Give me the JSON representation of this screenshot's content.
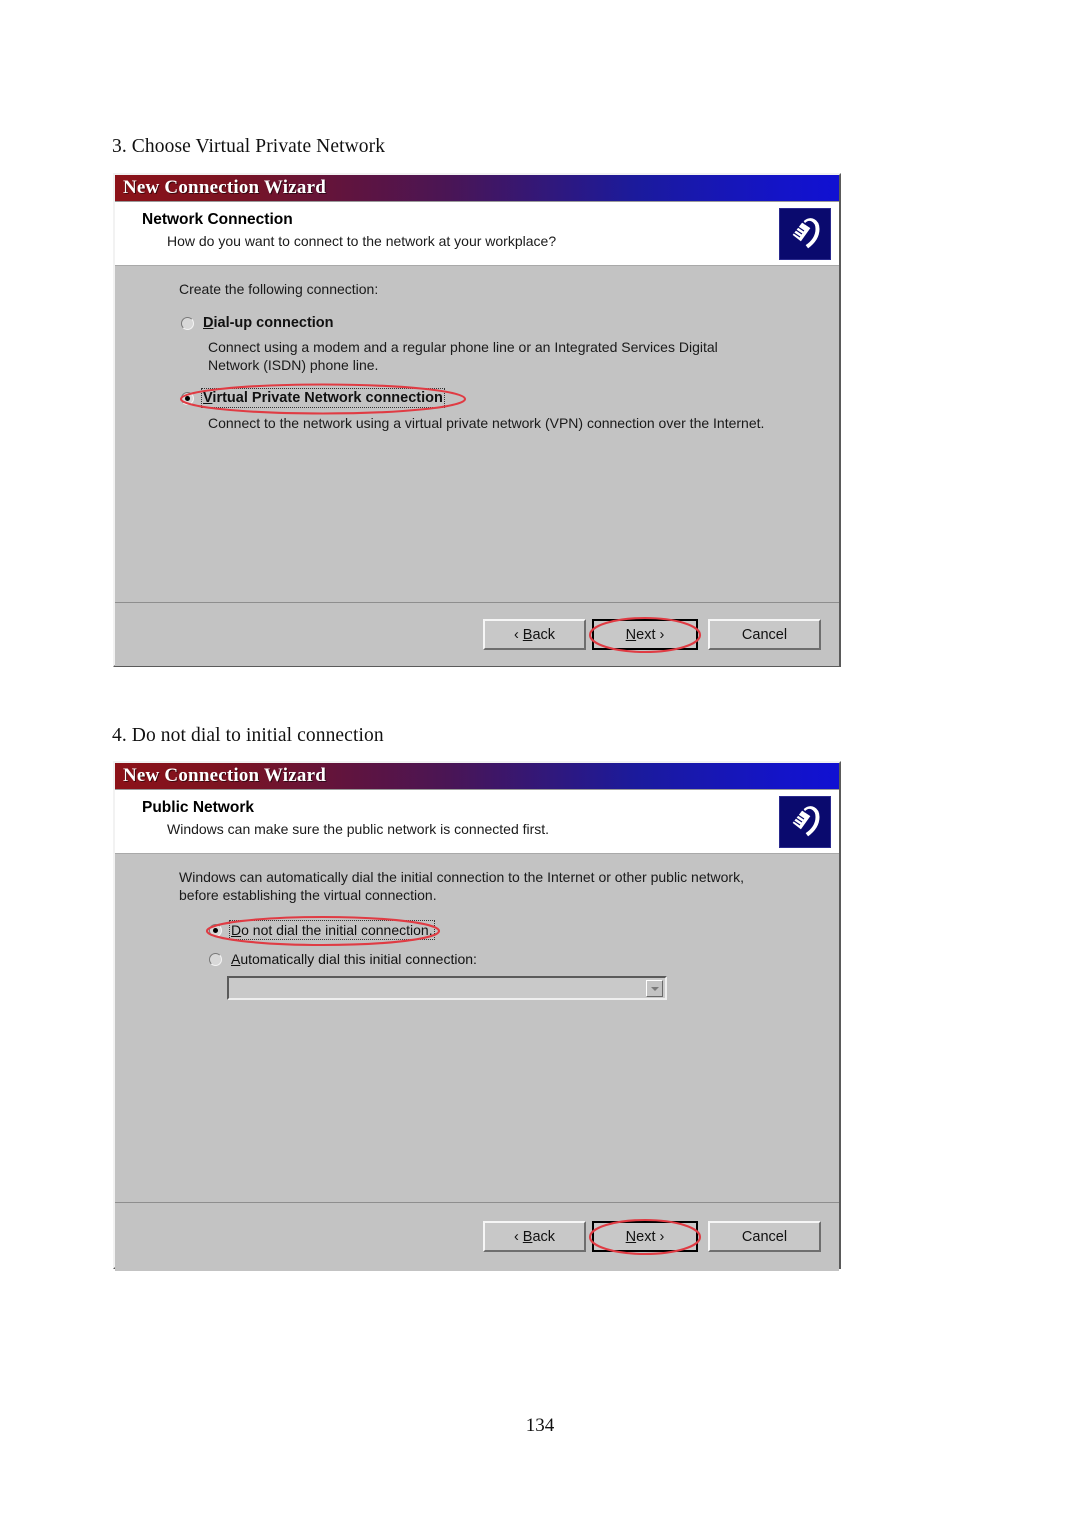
{
  "document": {
    "page_number": "134",
    "captions": [
      {
        "id": "c3",
        "text": "3. Choose Virtual Private Network"
      },
      {
        "id": "c4",
        "text": "4. Do not dial to initial connection"
      }
    ]
  },
  "colors": {
    "titlebar_start": "#8c1218",
    "titlebar_end": "#1010d2",
    "dialog_face": "#c3c3c3",
    "annotation_red": "#e03b43",
    "icon_background": "#0a0a6e"
  },
  "dialog1": {
    "title": "New Connection Wizard",
    "header_title": "Network Connection",
    "header_subtitle": "How do you want to connect to the network at your workplace?",
    "icon_name": "phone-handset-icon",
    "prompt": "Create the following connection:",
    "options": [
      {
        "label": "Dial-up connection",
        "accelerator": "D",
        "selected": false,
        "description_line1": "Connect using a modem and a regular phone line or an Integrated Services Digital",
        "description_line2": "Network (ISDN) phone line."
      },
      {
        "label": "Virtual Private Network connection",
        "accelerator": "V",
        "selected": true,
        "annotated": true,
        "description_line1": "Connect to the network using a virtual private network (VPN) connection over the Internet.",
        "description_line2": ""
      }
    ],
    "buttons": [
      {
        "name": "back",
        "label": "< Back",
        "accelerator": "B",
        "default": false,
        "annotated": false
      },
      {
        "name": "next",
        "label": "Next >",
        "accelerator": "N",
        "default": true,
        "annotated": true
      },
      {
        "name": "cancel",
        "label": "Cancel",
        "accelerator": "",
        "default": false,
        "annotated": false
      }
    ]
  },
  "dialog2": {
    "title": "New Connection Wizard",
    "header_title": "Public Network",
    "header_subtitle": "Windows can make sure the public network is connected first.",
    "icon_name": "phone-handset-icon",
    "prompt_line1": "Windows can automatically dial the initial connection to the Internet or other public network,",
    "prompt_line2": "before establishing the virtual connection.",
    "options": [
      {
        "label": "Do not dial the initial connection.",
        "accelerator": "D",
        "selected": true,
        "annotated": true
      },
      {
        "label": "Automatically dial this initial connection:",
        "accelerator": "A",
        "selected": false,
        "annotated": false
      }
    ],
    "combo": {
      "value": "",
      "placeholder": "",
      "enabled": false,
      "options": []
    },
    "buttons": [
      {
        "name": "back",
        "label": "< Back",
        "accelerator": "B",
        "default": false,
        "annotated": false
      },
      {
        "name": "next",
        "label": "Next >",
        "accelerator": "N",
        "default": true,
        "annotated": true
      },
      {
        "name": "cancel",
        "label": "Cancel",
        "accelerator": "",
        "default": false,
        "annotated": false
      }
    ]
  }
}
